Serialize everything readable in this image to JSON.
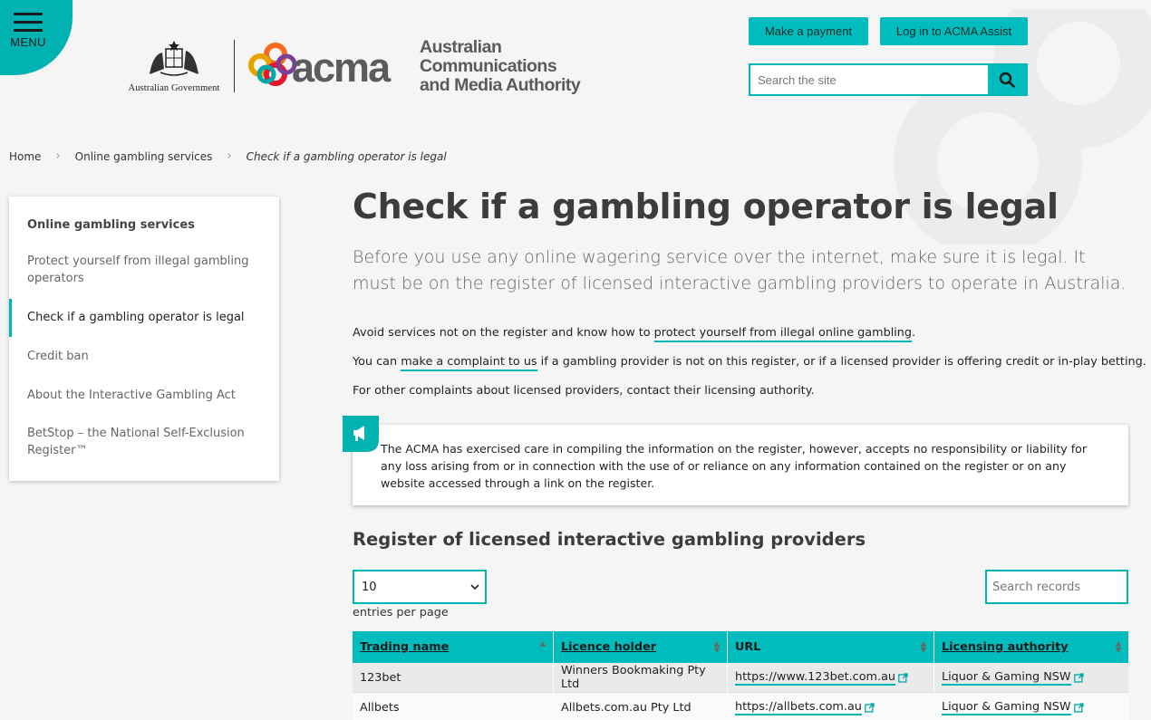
{
  "header": {
    "menu_label": "MENU",
    "gov_label": "Australian Government",
    "acma_wordmark": "acma",
    "org_name_line1": "Australian",
    "org_name_line2": "Communications",
    "org_name_line3": "and Media Authority",
    "payment_button": "Make a payment",
    "login_button": "Log in to ACMA Assist",
    "search_placeholder": "Search the site",
    "accent_color": "#00bcbc"
  },
  "breadcrumb": {
    "items": [
      "Home",
      "Online gambling services",
      "Check if a gambling operator is legal"
    ]
  },
  "sidebar": {
    "title": "Online gambling services",
    "items": [
      {
        "label": "Protect yourself from illegal gambling operators"
      },
      {
        "label": "Check if a gambling operator is legal",
        "active": true
      },
      {
        "label": "Credit ban"
      },
      {
        "label": "About the Interactive Gambling Act"
      },
      {
        "label": "BetStop – the National Self-Exclusion Register™"
      }
    ]
  },
  "main": {
    "title": "Check if a gambling operator is legal",
    "intro": "Before you use any online wagering service over the internet, make sure it is legal. It must be on the register of licensed interactive gambling providers to operate in Australia.",
    "p1_before": "Avoid services not on the register and know how to ",
    "p1_link": "protect yourself from illegal online gambling",
    "p1_after": ".",
    "p2_before": "You can ",
    "p2_link": "make a complaint to us",
    "p2_after": " if a gambling provider is not on this register, or if a licensed provider is offering credit or in-play betting.",
    "p3": "For other complaints about licensed providers, contact their licensing authority.",
    "notice": "The ACMA has exercised care in compiling the information on the register, however, accepts no responsibility or liability for any loss arising from or in connection with the use of or reliance on any information contained on the register or on any website accessed through a link on the register.",
    "register_title": "Register of licensed interactive gambling providers",
    "entries_value": "10",
    "entries_label": "entries per page",
    "records_placeholder": "Search records"
  },
  "table": {
    "headers": [
      "Trading name",
      "Licence holder",
      "URL",
      "Licensing authority"
    ],
    "rows": [
      {
        "trading_name": "123bet",
        "licence_holder": "Winners Bookmaking Pty Ltd",
        "url": "https://www.123bet.com.au",
        "authority": "Liquor & Gaming NSW"
      },
      {
        "trading_name": "Allbets",
        "licence_holder": "Allbets.com.au Pty Ltd",
        "url": "https://allbets.com.au",
        "authority": "Liquor & Gaming NSW"
      }
    ]
  }
}
